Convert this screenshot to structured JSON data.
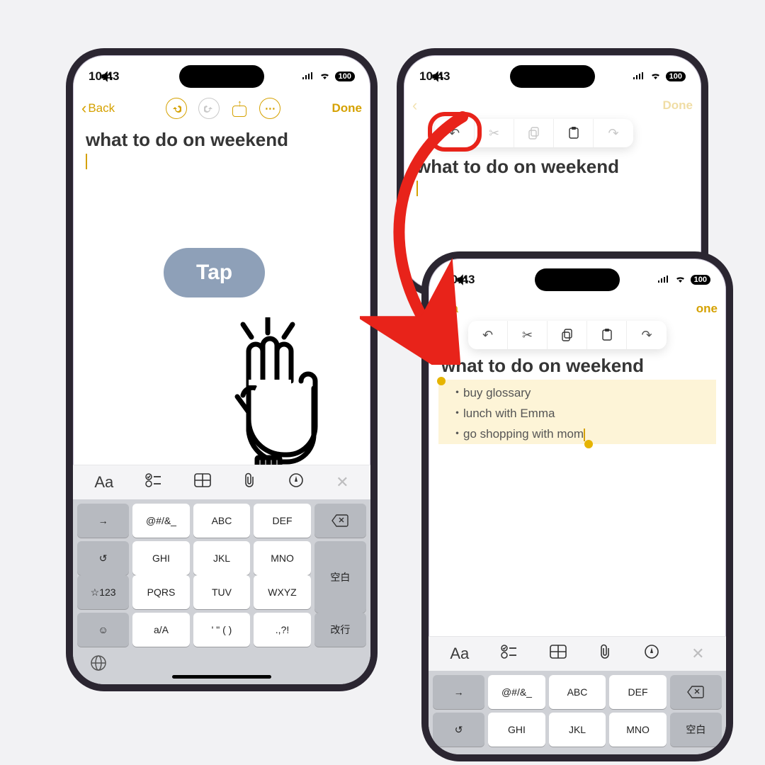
{
  "status": {
    "time": "10:43",
    "battery": "100"
  },
  "topbar": {
    "back": "Back",
    "done": "Done"
  },
  "note": {
    "title": "what to do on weekend",
    "items": [
      "buy glossary",
      "lunch with Emma",
      "go shopping with mom"
    ]
  },
  "tap_label": "Tap",
  "toolbar": {
    "aa": "Aa"
  },
  "keys": {
    "row1": [
      "@#/&_",
      "ABC",
      "DEF"
    ],
    "row2": [
      "GHI",
      "JKL",
      "MNO"
    ],
    "row3": [
      "PQRS",
      "TUV",
      "WXYZ"
    ],
    "row4": [
      "a/A",
      "' \" ( )",
      ".,?!"
    ],
    "star": "☆123",
    "space": "空白",
    "enter": "改行",
    "back_partial": "Ba",
    "done_partial": "one"
  }
}
